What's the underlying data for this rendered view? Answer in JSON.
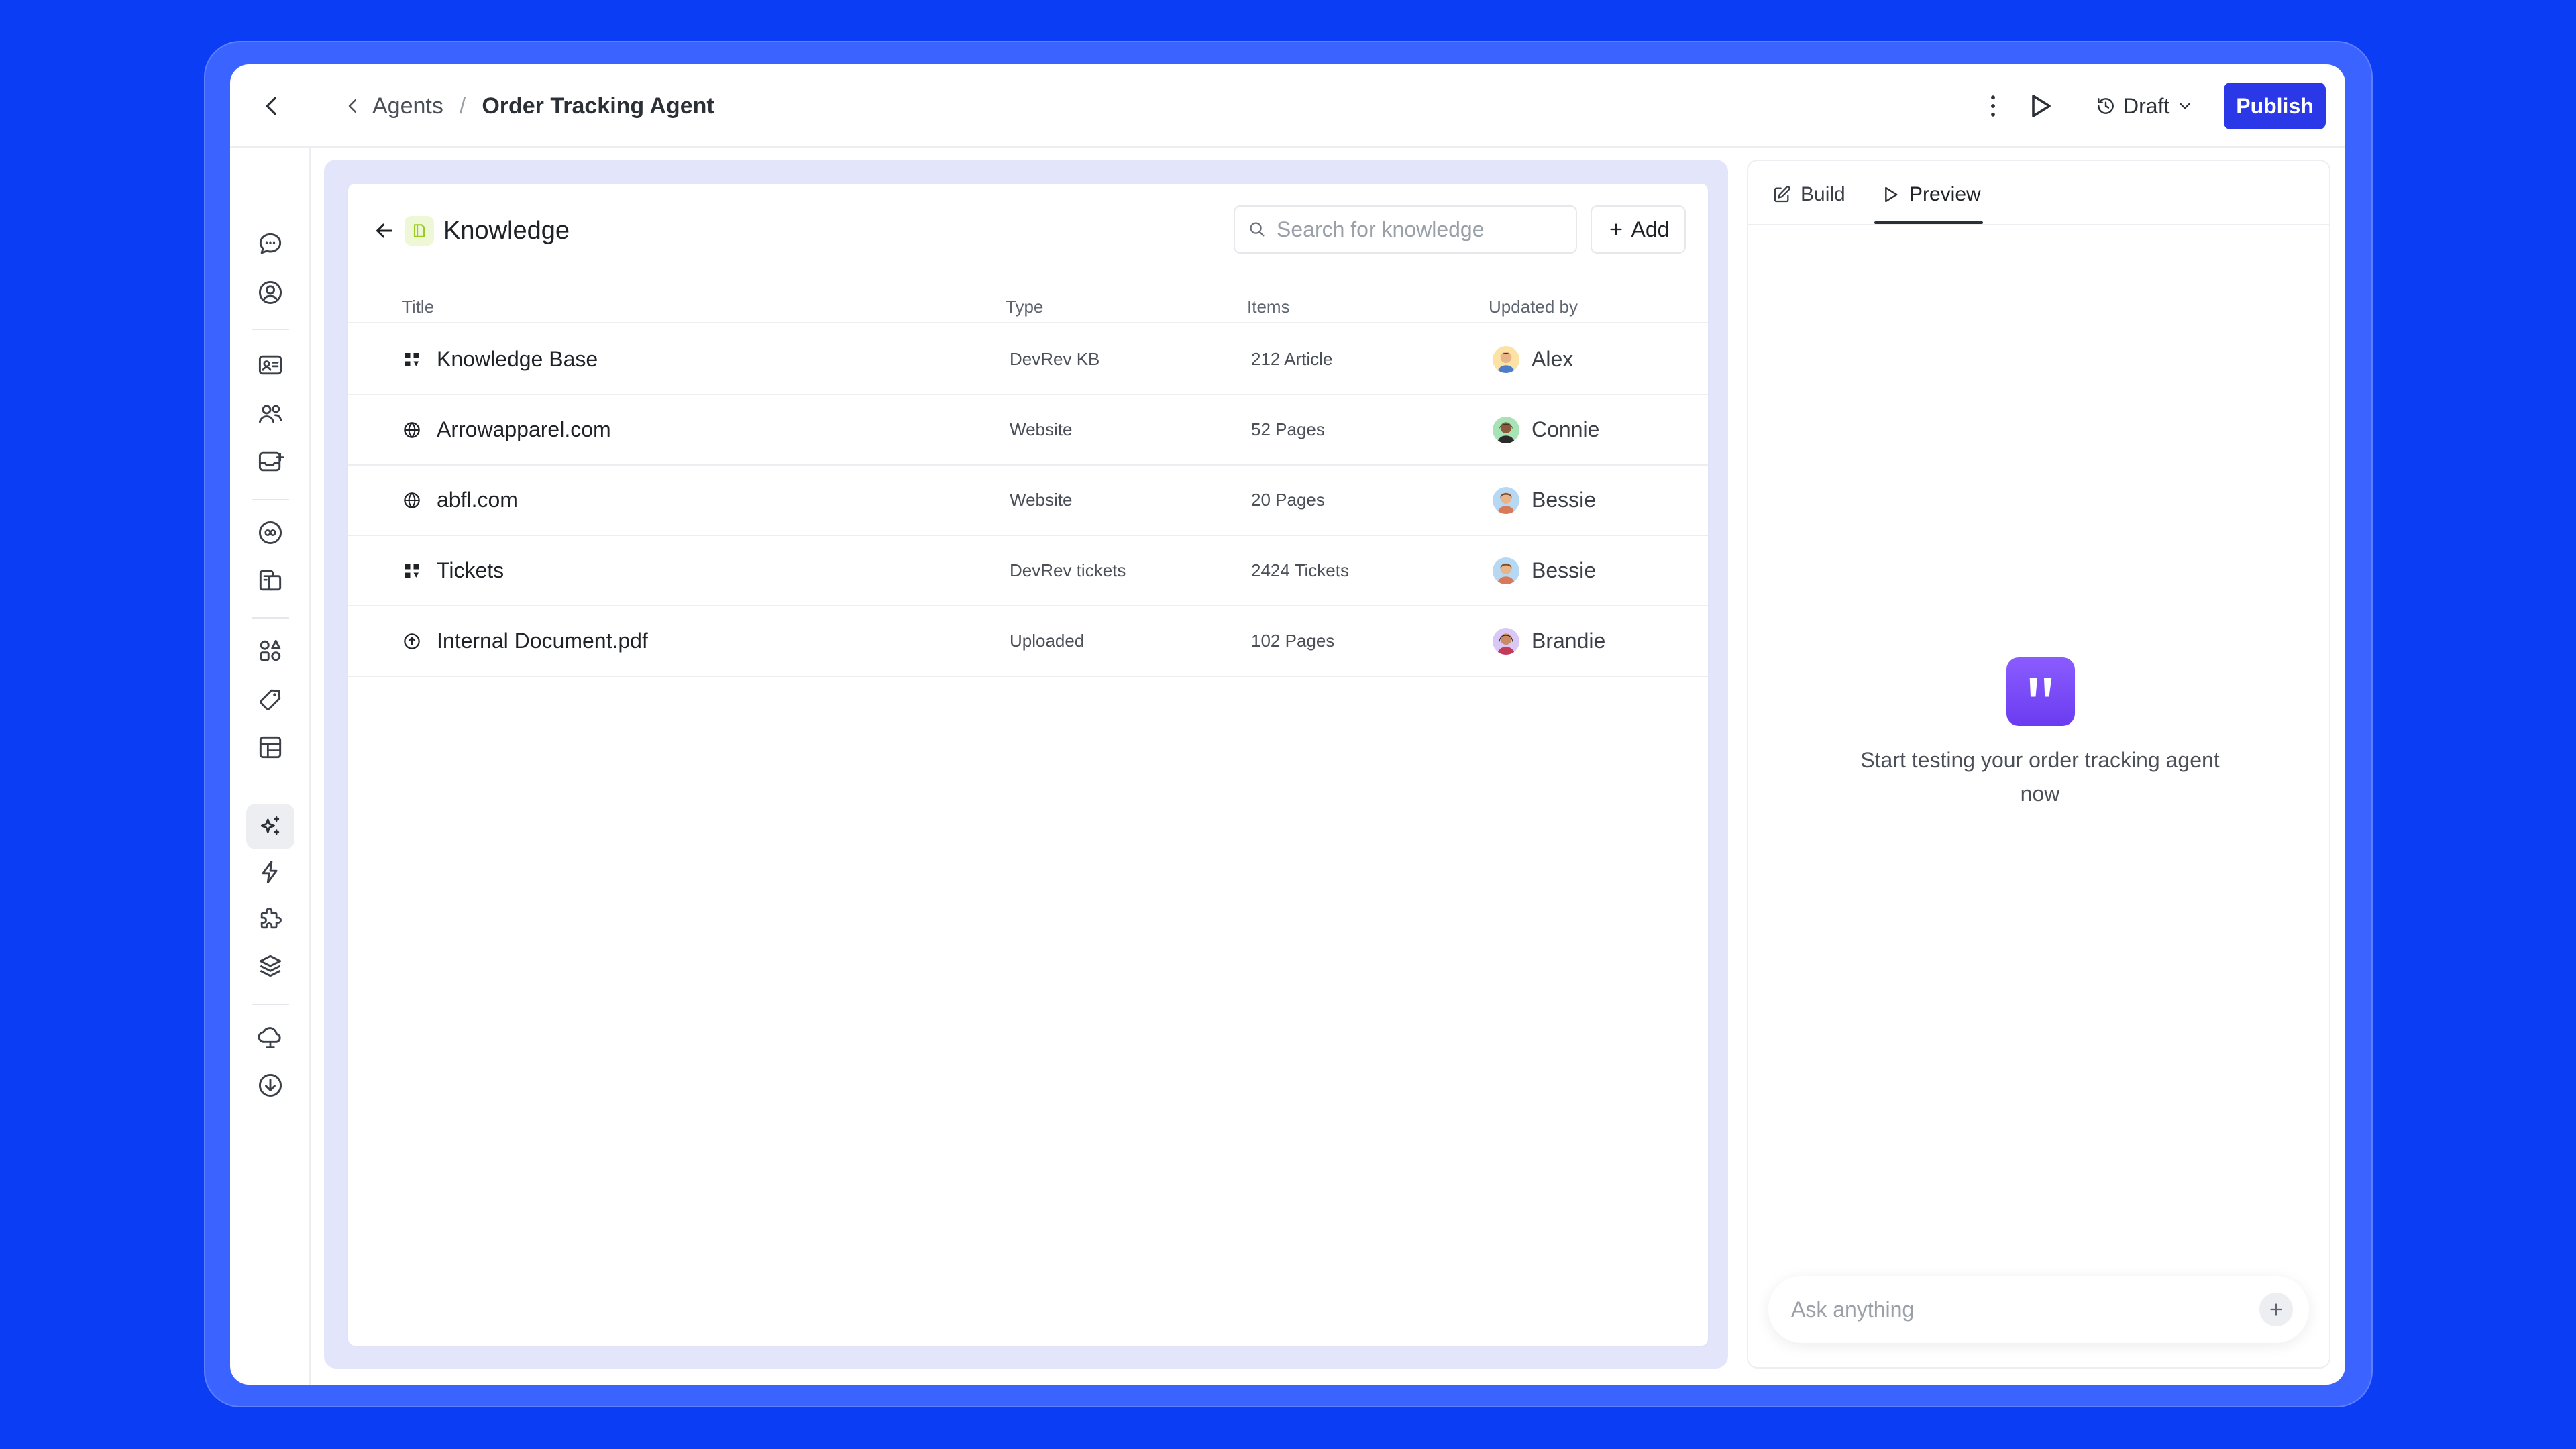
{
  "header": {
    "breadcrumb_parent": "Agents",
    "breadcrumb_separator": "/",
    "breadcrumb_current": "Order Tracking Agent",
    "draft_label": "Draft",
    "publish_label": "Publish"
  },
  "knowledge": {
    "title": "Knowledge",
    "search_placeholder": "Search for knowledge",
    "add_label": "Add",
    "columns": {
      "title": "Title",
      "type": "Type",
      "items": "Items",
      "updated_by": "Updated by"
    },
    "rows": [
      {
        "title": "Knowledge Base",
        "type": "DevRev KB",
        "items": "212 Article",
        "updated_by": "Alex",
        "icon": "devrev-icon"
      },
      {
        "title": "Arrowapparel.com",
        "type": "Website",
        "items": "52 Pages",
        "updated_by": "Connie",
        "icon": "globe-icon"
      },
      {
        "title": "abfl.com",
        "type": "Website",
        "items": "20 Pages",
        "updated_by": "Bessie",
        "icon": "globe-icon"
      },
      {
        "title": "Tickets",
        "type": "DevRev tickets",
        "items": "2424 Tickets",
        "updated_by": "Bessie",
        "icon": "devrev-icon"
      },
      {
        "title": "Internal Document.pdf",
        "type": "Uploaded",
        "items": "102 Pages",
        "updated_by": "Brandie",
        "icon": "upload-icon"
      }
    ]
  },
  "preview": {
    "tab_build": "Build",
    "tab_preview": "Preview",
    "active_tab": "Preview",
    "empty_text": "Start testing your order tracking agent now",
    "ask_placeholder": "Ask anything"
  },
  "colors": {
    "background": "#0b3df5",
    "frame": "#3b63ff",
    "publish": "#2a38e8",
    "logo_gradient_start": "#8a5cff",
    "logo_gradient_end": "#6b3cf0",
    "panel_tint": "#e3e6fb"
  }
}
